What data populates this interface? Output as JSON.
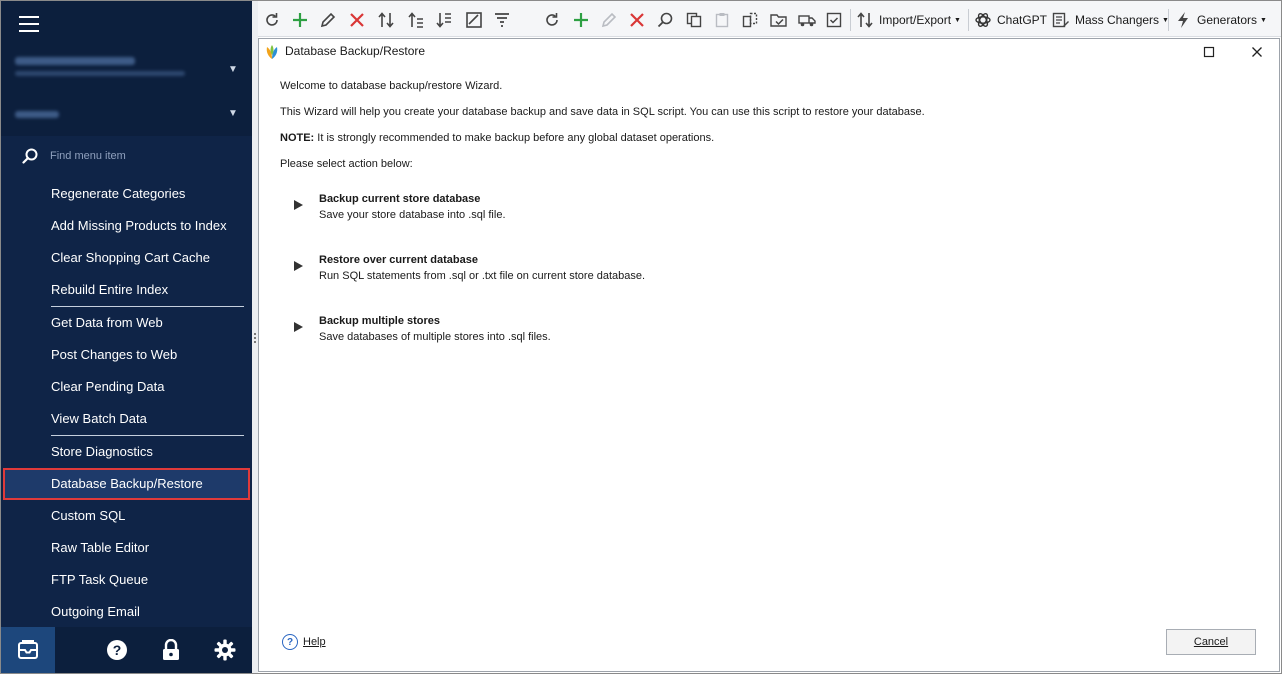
{
  "sidebar": {
    "search_placeholder": "Find menu item",
    "menu_groups": [
      [
        "Regenerate Categories",
        "Add Missing Products to Index",
        "Clear Shopping Cart Cache",
        "Rebuild Entire Index"
      ],
      [
        "Get Data from Web",
        "Post Changes to Web",
        "Clear Pending Data",
        "View Batch Data"
      ],
      [
        "Store Diagnostics",
        "Database Backup/Restore",
        "Custom SQL",
        "Raw Table Editor",
        "FTP Task Queue",
        "Outgoing Email"
      ]
    ],
    "active_item": "Database Backup/Restore",
    "bottom_icons": [
      "store-icon",
      "help-icon",
      "lock-icon",
      "settings-icon"
    ]
  },
  "toolbar": {
    "import_export": "Import/Export",
    "chatgpt": "ChatGPT",
    "mass_changers": "Mass Changers",
    "generators": "Generators"
  },
  "dialog": {
    "title": "Database Backup/Restore",
    "welcome": "Welcome to database backup/restore Wizard.",
    "intro": "This Wizard will help you create your database backup and save data in SQL script. You can use this script to restore your database.",
    "note_label": "NOTE:",
    "note_text": " It is strongly recommended to make backup before any global dataset operations.",
    "select_prompt": "Please select action below:",
    "actions": [
      {
        "title": "Backup current store database",
        "desc": "Save your store database into .sql file."
      },
      {
        "title": "Restore over current database",
        "desc": "Run SQL statements from .sql or .txt file on current store database."
      },
      {
        "title": "Backup multiple stores",
        "desc": "Save databases of multiple stores into .sql files."
      }
    ],
    "help_label": "Help",
    "cancel_label": "Cancel"
  },
  "colors": {
    "sidebar_bg": "#0f2447",
    "active_outline": "#e03a3a",
    "add_green": "#2ea043",
    "delete_red": "#d93636"
  }
}
